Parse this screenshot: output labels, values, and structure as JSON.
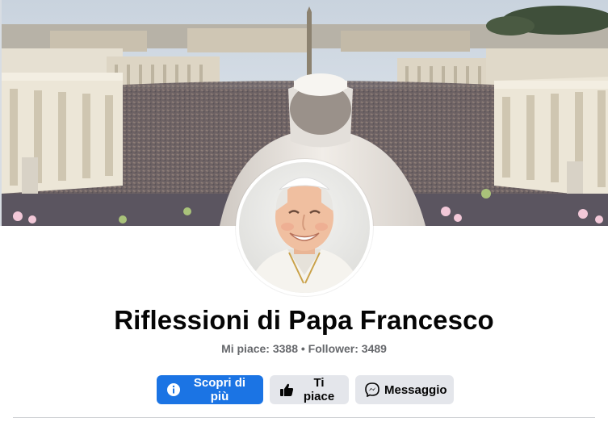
{
  "profile": {
    "name": "Riflessioni di Papa Francesco",
    "likes_label": "Mi piace",
    "likes_count": "3388",
    "followers_label": "Follower",
    "followers_count": "3489",
    "stats_text": "Mi piace: 3388 • Follower: 3489"
  },
  "actions": {
    "learn_more": {
      "label": "Scopri di più",
      "icon": "info-icon"
    },
    "like": {
      "label": "Ti piace",
      "icon": "thumbs-up-icon"
    },
    "message": {
      "label": "Messaggio",
      "icon": "messenger-icon"
    }
  },
  "colors": {
    "primary": "#1b74e4",
    "secondary_bg": "#e4e6eb",
    "text": "#050505",
    "muted": "#65676b"
  }
}
